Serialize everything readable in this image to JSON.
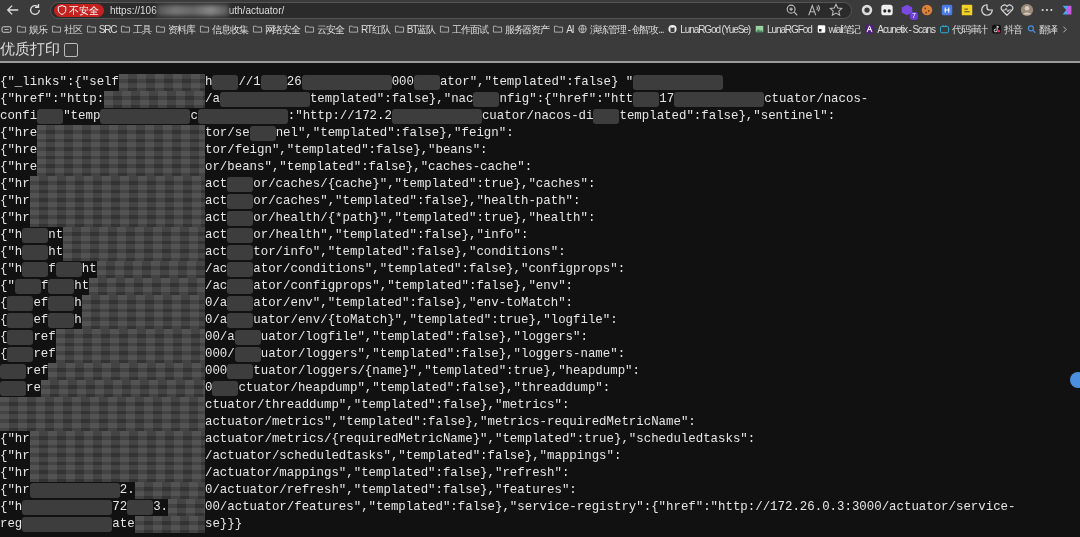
{
  "address_bar": {
    "security_badge": "不安全",
    "url": [
      "https://106",
      {
        "kind": "blur"
      },
      "uth/actuator/"
    ],
    "extension_badge": "7"
  },
  "bookmarks": [
    {
      "kind": "folder",
      "label": "娱乐"
    },
    {
      "kind": "folder",
      "label": "社区"
    },
    {
      "kind": "folder",
      "label": "SRC"
    },
    {
      "kind": "folder",
      "label": "工具"
    },
    {
      "kind": "folder",
      "label": "资料库"
    },
    {
      "kind": "folder",
      "label": "信息收集"
    },
    {
      "kind": "folder",
      "label": "网络安全"
    },
    {
      "kind": "folder",
      "label": "云安全"
    },
    {
      "kind": "folder",
      "label": "RT红队"
    },
    {
      "kind": "folder",
      "label": "BT蓝队"
    },
    {
      "kind": "folder",
      "label": "工作面试"
    },
    {
      "kind": "folder",
      "label": "服务器资产"
    },
    {
      "kind": "folder",
      "label": "AI"
    },
    {
      "kind": "globe",
      "label": "演练管理 - 创智攻..."
    },
    {
      "kind": "github",
      "label": "LunaRGod (YueSe)"
    },
    {
      "kind": "photo",
      "label": "LunaRGFod"
    },
    {
      "kind": "note",
      "label": "wiali笔记"
    },
    {
      "kind": "letter",
      "label": "Acunetix - Scans"
    },
    {
      "kind": "tv",
      "label": "代码审计"
    },
    {
      "kind": "music",
      "label": "抖音"
    },
    {
      "kind": "search",
      "label": "翻译"
    }
  ],
  "pretty_print": {
    "label": "优质打印",
    "checked": false
  },
  "json_lines": [
    [
      "{\"_links\":{\"self",
      {
        "kind": "mosaic"
      },
      "h",
      {
        "kind": "blur"
      },
      "//1",
      {
        "kind": "blur"
      },
      "26",
      {
        "kind": "wide"
      },
      "000",
      {
        "kind": "blur"
      },
      "ator\",\"templated\":false} \"",
      {
        "kind": "wide"
      }
    ],
    [
      "{\"href\":\"http:",
      {
        "kind": "mosaic"
      },
      "/a",
      {
        "kind": "wide"
      },
      "templated\":false},\"nac",
      {
        "kind": "blur"
      },
      "nfig\":{\"href\":\"htt",
      {
        "kind": "blur"
      },
      "17",
      {
        "kind": "wide"
      },
      "ctuator/nacos-"
    ],
    [
      "confi",
      {
        "kind": "blur"
      },
      "\"temp",
      {
        "kind": "wide"
      },
      "c",
      {
        "kind": "wide"
      },
      ":\"http://172.2",
      {
        "kind": "wide"
      },
      "cuator/nacos-di",
      {
        "kind": "blur"
      },
      "templated\":false},\"sentinel\":"
    ],
    [
      "{\"hre",
      {
        "kind": "mosaic"
      },
      "tor/se",
      {
        "kind": "blur"
      },
      "nel\",\"templated\":false},\"feign\":"
    ],
    [
      "{\"hre",
      {
        "kind": "mosaic"
      },
      "tor/feign\",\"templated\":false},\"beans\":"
    ],
    [
      "{\"hre",
      {
        "kind": "mosaic"
      },
      "or/beans\",\"templated\":false},\"caches-cache\":"
    ],
    [
      "{\"hr",
      {
        "kind": "mosaic"
      },
      "act",
      {
        "kind": "blur"
      },
      "or/caches/{cache}\",\"templated\":true},\"caches\":"
    ],
    [
      "{\"hr",
      {
        "kind": "mosaic"
      },
      "act",
      {
        "kind": "blur"
      },
      "or/caches\",\"templated\":false},\"health-path\":"
    ],
    [
      "{\"hr",
      {
        "kind": "mosaic"
      },
      "act",
      {
        "kind": "blur"
      },
      "or/health/{*path}\",\"templated\":true},\"health\":"
    ],
    [
      "{\"h",
      {
        "kind": "blur"
      },
      "nt",
      {
        "kind": "mosaic"
      },
      "act",
      {
        "kind": "blur"
      },
      "or/health\",\"templated\":false},\"info\":"
    ],
    [
      "{\"h",
      {
        "kind": "blur"
      },
      "ht",
      {
        "kind": "mosaic"
      },
      "act",
      {
        "kind": "blur"
      },
      "tor/info\",\"templated\":false},\"conditions\":"
    ],
    [
      "{\"h",
      {
        "kind": "blur"
      },
      "f",
      {
        "kind": "blur"
      },
      "ht",
      {
        "kind": "mosaic"
      },
      "/ac",
      {
        "kind": "blur"
      },
      "ator/conditions\",\"templated\":false},\"configprops\":"
    ],
    [
      "{\"",
      {
        "kind": "blur"
      },
      "f",
      {
        "kind": "blur"
      },
      "ht",
      {
        "kind": "mosaic"
      },
      "/ac",
      {
        "kind": "blur"
      },
      "ator/configprops\",\"templated\":false},\"env\":"
    ],
    [
      "{",
      {
        "kind": "blur"
      },
      "ef",
      {
        "kind": "blur"
      },
      "h",
      {
        "kind": "mosaic"
      },
      "0/a",
      {
        "kind": "blur"
      },
      "ator/env\",\"templated\":false},\"env-toMatch\":"
    ],
    [
      "{",
      {
        "kind": "blur"
      },
      "ef",
      {
        "kind": "blur"
      },
      "h",
      {
        "kind": "mosaic"
      },
      "0/a",
      {
        "kind": "blur"
      },
      "uator/env/{toMatch}\",\"templated\":true},\"logfile\":"
    ],
    [
      "{",
      {
        "kind": "blur"
      },
      "ref",
      {
        "kind": "mosaic"
      },
      "00/a",
      {
        "kind": "blur"
      },
      "uator/logfile\",\"templated\":false},\"loggers\":"
    ],
    [
      "{",
      {
        "kind": "blur"
      },
      "ref",
      {
        "kind": "mosaic"
      },
      "000/",
      {
        "kind": "blur"
      },
      "uator/loggers\",\"templated\":false},\"loggers-name\":"
    ],
    [
      {
        "kind": "blur"
      },
      "ref",
      {
        "kind": "mosaic"
      },
      "000",
      {
        "kind": "blur"
      },
      "tuator/loggers/{name}\",\"templated\":true},\"heapdump\":"
    ],
    [
      {
        "kind": "blur"
      },
      "re",
      {
        "kind": "mosaic"
      },
      "0",
      {
        "kind": "blur"
      },
      "ctuator/heapdump\",\"templated\":false},\"threaddump\":"
    ],
    [
      {
        "kind": "mosaic"
      },
      "ctuator/threaddump\",\"templated\":false},\"metrics\":"
    ],
    [
      {
        "kind": "mosaic"
      },
      "actuator/metrics\",\"templated\":false},\"metrics-requiredMetricName\":"
    ],
    [
      "{\"hr",
      {
        "kind": "mosaic"
      },
      "actuator/metrics/{requiredMetricName}\",\"templated\":true},\"scheduledtasks\":"
    ],
    [
      "{\"hr",
      {
        "kind": "mosaic"
      },
      "/actuator/scheduledtasks\",\"templated\":false},\"mappings\":"
    ],
    [
      "{\"hr",
      {
        "kind": "mosaic"
      },
      "/actuator/mappings\",\"templated\":false},\"refresh\":"
    ],
    [
      "{\"hr",
      {
        "kind": "wide"
      },
      "2.",
      {
        "kind": "mosaic"
      },
      "0/actuator/refresh\",\"templated\":false},\"features\":"
    ],
    [
      "{\"h",
      {
        "kind": "wide"
      },
      "72",
      {
        "kind": "blur"
      },
      "3.",
      {
        "kind": "mosaic"
      },
      "00/actuator/features\",\"templated\":false},\"service-registry\":{\"href\":\"http://172.26.0.3:3000/actuator/service-"
    ],
    [
      "reg",
      {
        "kind": "wide"
      },
      "ate",
      {
        "kind": "mosaic"
      },
      "se}}}"
    ]
  ]
}
